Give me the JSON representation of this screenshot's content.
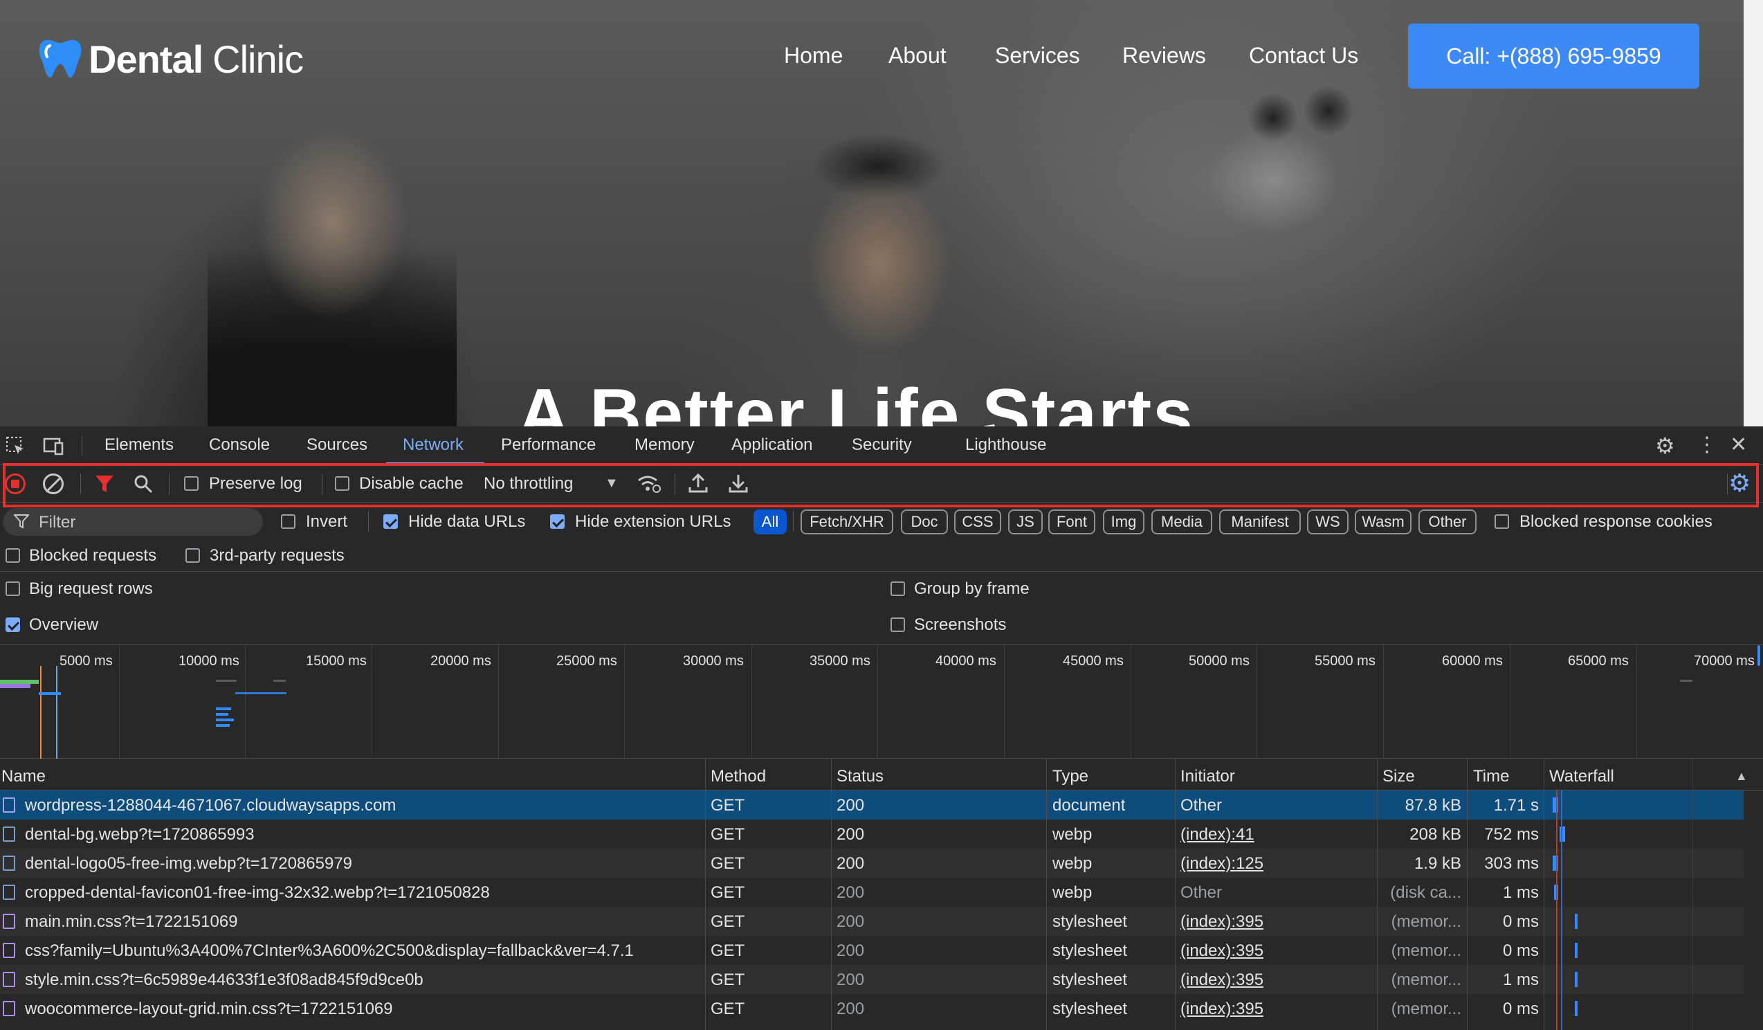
{
  "website": {
    "logo_bold": "Dental",
    "logo_thin": "Clinic",
    "nav": [
      "Home",
      "About",
      "Services",
      "Reviews",
      "Contact Us"
    ],
    "cta": "Call: +(888) 695-9859",
    "hero_title": "A Better Life Starts"
  },
  "devtools": {
    "tabs": [
      "Elements",
      "Console",
      "Sources",
      "Network",
      "Performance",
      "Memory",
      "Application",
      "Security",
      "Lighthouse"
    ],
    "active_tab": "Network",
    "toolbar": {
      "preserve_log": "Preserve log",
      "disable_cache": "Disable cache",
      "throttling": "No throttling"
    },
    "filter": {
      "placeholder": "Filter",
      "invert": "Invert",
      "hide_data_urls": "Hide data URLs",
      "hide_extension_urls": "Hide extension URLs",
      "types": [
        "All",
        "Fetch/XHR",
        "Doc",
        "CSS",
        "JS",
        "Font",
        "Img",
        "Media",
        "Manifest",
        "WS",
        "Wasm",
        "Other"
      ],
      "blocked_response_cookies": "Blocked response cookies",
      "blocked_requests": "Blocked requests",
      "third_party": "3rd-party requests"
    },
    "settings": {
      "big_rows": "Big request rows",
      "group_by_frame": "Group by frame",
      "overview": "Overview",
      "screenshots": "Screenshots"
    },
    "overview_ticks": [
      "5000 ms",
      "10000 ms",
      "15000 ms",
      "20000 ms",
      "25000 ms",
      "30000 ms",
      "35000 ms",
      "40000 ms",
      "45000 ms",
      "50000 ms",
      "55000 ms",
      "60000 ms",
      "65000 ms",
      "70000 ms"
    ],
    "columns": [
      "Name",
      "Method",
      "Status",
      "Type",
      "Initiator",
      "Size",
      "Time",
      "Waterfall"
    ],
    "rows": [
      {
        "name": "wordpress-1288044-4671067.cloudwaysapps.com",
        "method": "GET",
        "status": "200",
        "type": "document",
        "initiator": "Other",
        "size": "87.8 kB",
        "time": "1.71 s"
      },
      {
        "name": "dental-bg.webp?t=1720865993",
        "method": "GET",
        "status": "200",
        "type": "webp",
        "initiator": "(index):41",
        "size": "208 kB",
        "time": "752 ms"
      },
      {
        "name": "dental-logo05-free-img.webp?t=1720865979",
        "method": "GET",
        "status": "200",
        "type": "webp",
        "initiator": "(index):125",
        "size": "1.9 kB",
        "time": "303 ms"
      },
      {
        "name": "cropped-dental-favicon01-free-img-32x32.webp?t=1721050828",
        "method": "GET",
        "status": "200",
        "type": "webp",
        "initiator": "Other",
        "size": "(disk ca...",
        "time": "1 ms"
      },
      {
        "name": "main.min.css?t=1722151069",
        "method": "GET",
        "status": "200",
        "type": "stylesheet",
        "initiator": "(index):395",
        "size": "(memor...",
        "time": "0 ms"
      },
      {
        "name": "css?family=Ubuntu%3A400%7CInter%3A600%2C500&display=fallback&ver=4.7.1",
        "method": "GET",
        "status": "200",
        "type": "stylesheet",
        "initiator": "(index):395",
        "size": "(memor...",
        "time": "0 ms"
      },
      {
        "name": "style.min.css?t=6c5989e44633f1e3f08ad845f9d9ce0b",
        "method": "GET",
        "status": "200",
        "type": "stylesheet",
        "initiator": "(index):395",
        "size": "(memor...",
        "time": "1 ms"
      },
      {
        "name": "woocommerce-layout-grid.min.css?t=1722151069",
        "method": "GET",
        "status": "200",
        "type": "stylesheet",
        "initiator": "(index):395",
        "size": "(memor...",
        "time": "0 ms"
      }
    ]
  }
}
